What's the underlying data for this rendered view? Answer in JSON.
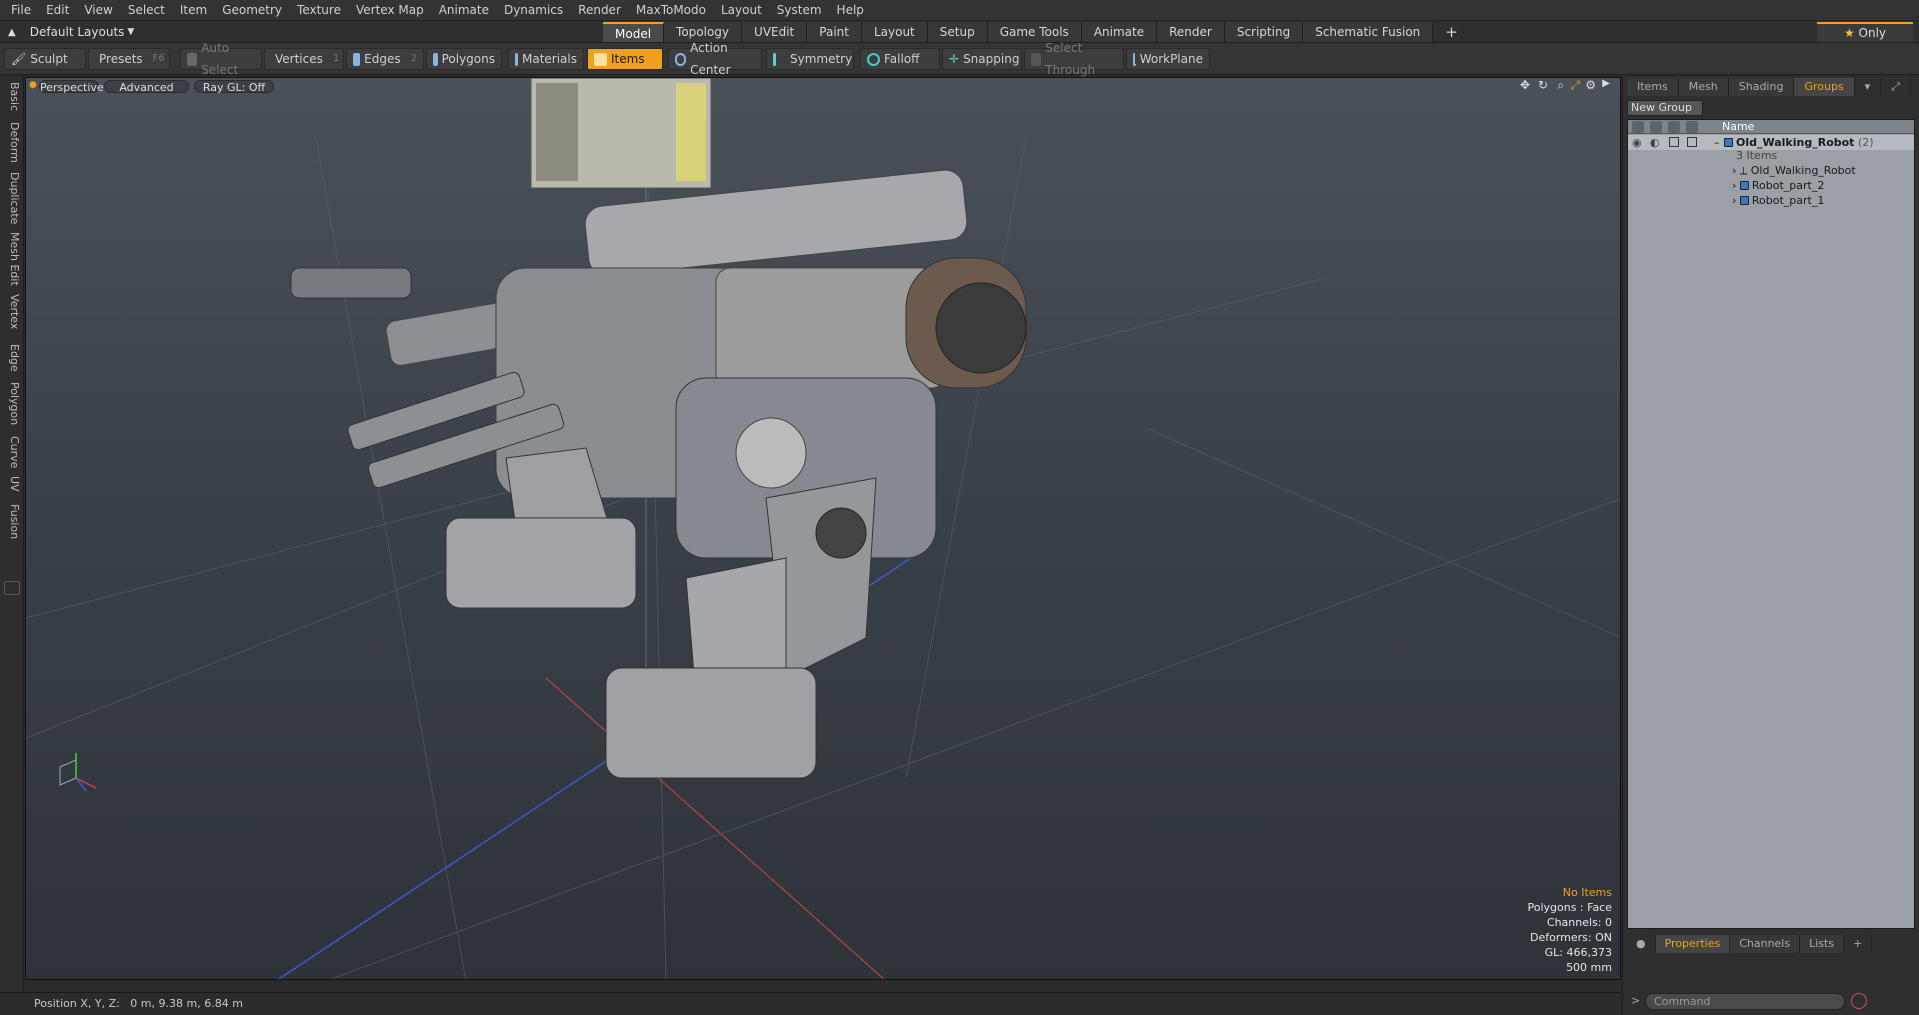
{
  "menu": [
    "File",
    "Edit",
    "View",
    "Select",
    "Item",
    "Geometry",
    "Texture",
    "Vertex Map",
    "Animate",
    "Dynamics",
    "Render",
    "MaxToModo",
    "Layout",
    "System",
    "Help"
  ],
  "layout": {
    "selector": "Default Layouts",
    "tabs": [
      "Model",
      "Topology",
      "UVEdit",
      "Paint",
      "Layout",
      "Setup",
      "Game Tools",
      "Animate",
      "Render",
      "Scripting",
      "Schematic Fusion"
    ],
    "active": "Model",
    "only": "Only"
  },
  "toolbar": {
    "sculpt": "Sculpt",
    "presets": "Presets",
    "presets_key": "F6",
    "auto_select": "Auto Select",
    "vertices": "Vertices",
    "vertices_key": "1",
    "edges": "Edges",
    "edges_key": "2",
    "polygons": "Polygons",
    "materials": "Materials",
    "items": "Items",
    "action_center": "Action Center",
    "symmetry": "Symmetry",
    "falloff": "Falloff",
    "snapping": "Snapping",
    "select_through": "Select Through",
    "workplane": "WorkPlane"
  },
  "left_tabs": [
    "Basic",
    "Deform",
    "Duplicate",
    "Mesh Edit",
    "Vertex",
    "Edge",
    "Polygon",
    "Curve",
    "UV",
    "Fusion"
  ],
  "viewport": {
    "view": "Perspective",
    "shading": "Advanced",
    "raygl": "Ray GL: Off",
    "stats": {
      "items": "No Items",
      "polygons": "Polygons : Face",
      "channels": "Channels: 0",
      "deformers": "Deformers: ON",
      "gl": "GL: 466,373",
      "scale": "500 mm"
    }
  },
  "status": "Position X, Y, Z:   0 m, 9.38 m, 6.84 m",
  "panel": {
    "tabs": [
      "Items",
      "Mesh ...",
      "Shading",
      "Groups"
    ],
    "active_tab": "Groups",
    "new_group": "New Group",
    "col_name": "Name",
    "group": {
      "name": "Old_Walking_Robot",
      "count": "(2)",
      "sub": "3 Items"
    },
    "children": [
      "Old_Walking_Robot",
      "Robot_part_2",
      "Robot_part_1"
    ],
    "bottom_tabs": [
      "Properties",
      "Channels",
      "Lists"
    ],
    "bottom_active": "Properties",
    "command_placeholder": "Command"
  },
  "colors": {
    "accent": "#f0a020",
    "panel": "#2f2f2f"
  }
}
